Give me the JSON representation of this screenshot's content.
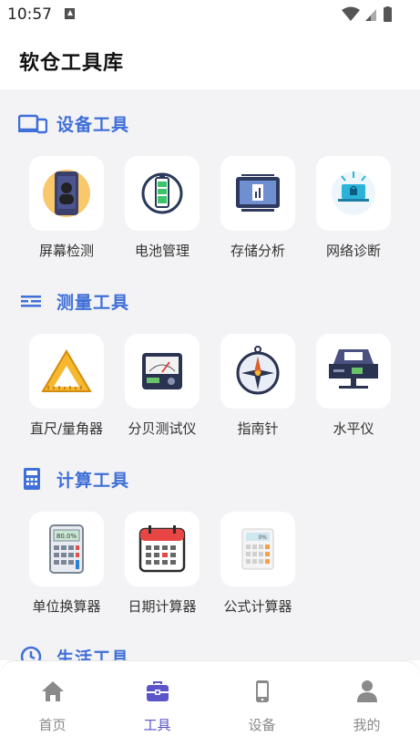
{
  "status_bar": {
    "time": "10:57"
  },
  "app_title": "软仓工具库",
  "sections": [
    {
      "title": "设备工具",
      "tools": [
        {
          "label": "屏幕检测",
          "icon": "phone-screen-icon"
        },
        {
          "label": "电池管理",
          "icon": "battery-icon"
        },
        {
          "label": "存储分析",
          "icon": "storage-chip-icon"
        },
        {
          "label": "网络诊断",
          "icon": "network-laptop-icon"
        }
      ]
    },
    {
      "title": "测量工具",
      "tools": [
        {
          "label": "直尺/量角器",
          "icon": "ruler-triangle-icon"
        },
        {
          "label": "分贝测试仪",
          "icon": "decibel-meter-icon"
        },
        {
          "label": "指南针",
          "icon": "compass-icon"
        },
        {
          "label": "水平仪",
          "icon": "level-icon"
        }
      ]
    },
    {
      "title": "计算工具",
      "tools": [
        {
          "label": "单位换算器",
          "icon": "calculator-icon"
        },
        {
          "label": "日期计算器",
          "icon": "calendar-icon"
        },
        {
          "label": "公式计算器",
          "icon": "formula-calculator-icon"
        }
      ]
    },
    {
      "title": "生活工具",
      "tools": []
    }
  ],
  "bottom_nav": [
    {
      "label": "首页",
      "icon": "home-icon",
      "active": false
    },
    {
      "label": "工具",
      "icon": "toolbox-icon",
      "active": true
    },
    {
      "label": "设备",
      "icon": "phone-icon",
      "active": false
    },
    {
      "label": "我的",
      "icon": "person-icon",
      "active": false
    }
  ],
  "colors": {
    "accent": "#3f6fd8",
    "nav_active": "#5b55c9",
    "nav_inactive": "#8a8a8a",
    "background": "#f3f3f5"
  }
}
